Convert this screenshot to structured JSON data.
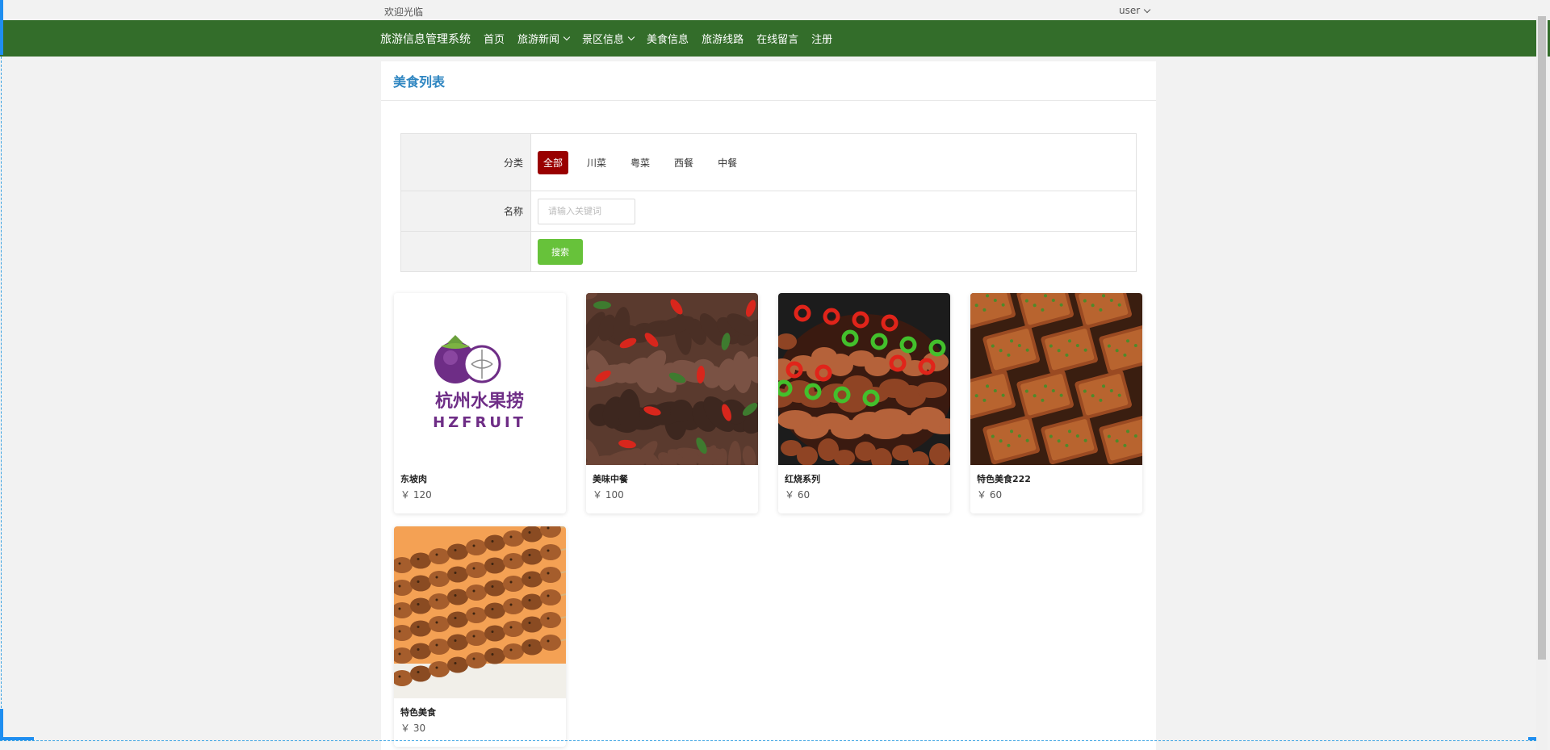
{
  "topbar": {
    "welcome": "欢迎光临",
    "user": "user"
  },
  "nav": {
    "brand": "旅游信息管理系统",
    "items": [
      {
        "label": "首页",
        "dropdown": false
      },
      {
        "label": "旅游新闻",
        "dropdown": true
      },
      {
        "label": "景区信息",
        "dropdown": true
      },
      {
        "label": "美食信息",
        "dropdown": false
      },
      {
        "label": "旅游线路",
        "dropdown": false
      },
      {
        "label": "在线留言",
        "dropdown": false
      },
      {
        "label": "注册",
        "dropdown": false
      }
    ]
  },
  "panel": {
    "title": "美食列表"
  },
  "filter": {
    "category_label": "分类",
    "categories": [
      "全部",
      "川菜",
      "粤菜",
      "西餐",
      "中餐"
    ],
    "selected_category": "全部",
    "name_label": "名称",
    "name_placeholder": "请输入关键词",
    "name_value": "",
    "search_button": "搜索"
  },
  "foods": [
    {
      "name": "东坡肉",
      "price": "￥ 120",
      "image": "logo"
    },
    {
      "name": "美味中餐",
      "price": "￥ 100",
      "image": "beef-pepper"
    },
    {
      "name": "红烧系列",
      "price": "￥ 60",
      "image": "braised"
    },
    {
      "name": "特色美食222",
      "price": "￥ 60",
      "image": "tofu"
    },
    {
      "name": "特色美食",
      "price": "￥ 30",
      "image": "skewers"
    }
  ],
  "logo": {
    "cn": "杭州水果捞",
    "en": "HZFRUIT"
  },
  "colors": {
    "nav": "#336d2a",
    "accent": "#2f86c1",
    "active_category": "#990000",
    "search_button": "#67c23a"
  }
}
